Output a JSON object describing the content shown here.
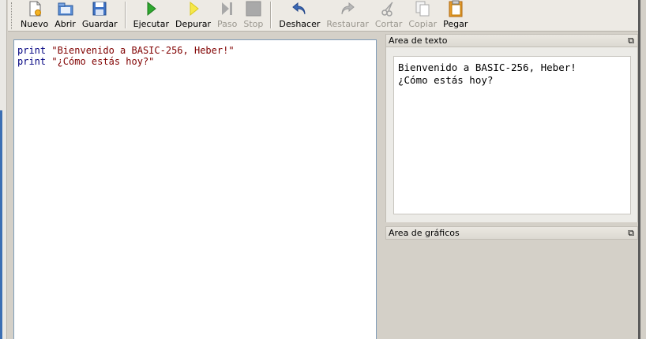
{
  "toolbar": {
    "buttons": [
      {
        "label": "Nuevo",
        "icon": "new-file-icon",
        "enabled": true
      },
      {
        "label": "Abrir",
        "icon": "open-folder-icon",
        "enabled": true
      },
      {
        "label": "Guardar",
        "icon": "save-disk-icon",
        "enabled": true
      },
      {
        "label": "Ejecutar",
        "icon": "run-play-icon",
        "enabled": true
      },
      {
        "label": "Depurar",
        "icon": "debug-play-icon",
        "enabled": true
      },
      {
        "label": "Paso",
        "icon": "step-icon",
        "enabled": false
      },
      {
        "label": "Stop",
        "icon": "stop-icon",
        "enabled": false
      },
      {
        "label": "Deshacer",
        "icon": "undo-icon",
        "enabled": true
      },
      {
        "label": "Restaurar",
        "icon": "redo-icon",
        "enabled": false
      },
      {
        "label": "Cortar",
        "icon": "scissors-icon",
        "enabled": false
      },
      {
        "label": "Copiar",
        "icon": "copy-icon",
        "enabled": false
      },
      {
        "label": "Pegar",
        "icon": "paste-icon",
        "enabled": true
      }
    ]
  },
  "editor": {
    "lines": [
      {
        "keyword": "print",
        "string": "\"Bienvenido a BASIC-256, Heber!\""
      },
      {
        "keyword": "print",
        "string": "\"¿Cómo estás hoy?\""
      }
    ]
  },
  "text_panel": {
    "title": "Area de texto",
    "float_icon": "⧉",
    "output_lines": [
      "Bienvenido a BASIC-256, Heber!",
      "¿Cómo estás hoy?"
    ]
  },
  "graphics_panel": {
    "title": "Area de gráficos",
    "float_icon": "⧉"
  }
}
